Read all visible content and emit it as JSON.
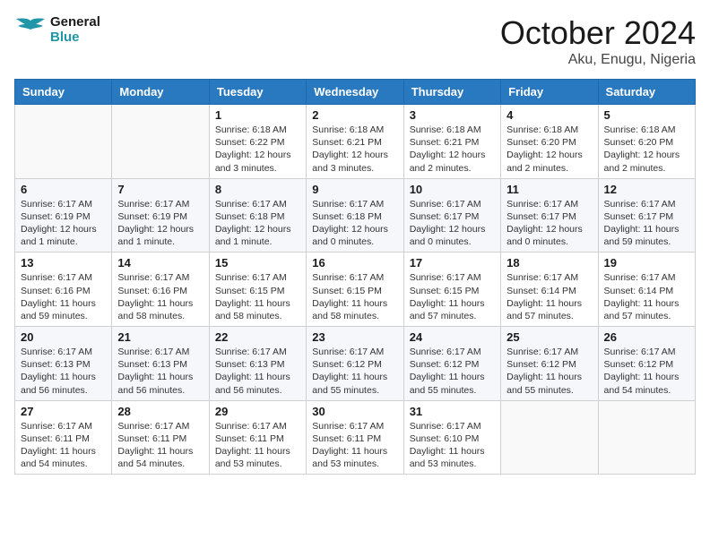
{
  "header": {
    "logo_line1": "General",
    "logo_line2": "Blue",
    "month_title": "October 2024",
    "location": "Aku, Enugu, Nigeria"
  },
  "weekdays": [
    "Sunday",
    "Monday",
    "Tuesday",
    "Wednesday",
    "Thursday",
    "Friday",
    "Saturday"
  ],
  "weeks": [
    [
      {
        "day": "",
        "info": ""
      },
      {
        "day": "",
        "info": ""
      },
      {
        "day": "1",
        "info": "Sunrise: 6:18 AM\nSunset: 6:22 PM\nDaylight: 12 hours and 3 minutes."
      },
      {
        "day": "2",
        "info": "Sunrise: 6:18 AM\nSunset: 6:21 PM\nDaylight: 12 hours and 3 minutes."
      },
      {
        "day": "3",
        "info": "Sunrise: 6:18 AM\nSunset: 6:21 PM\nDaylight: 12 hours and 2 minutes."
      },
      {
        "day": "4",
        "info": "Sunrise: 6:18 AM\nSunset: 6:20 PM\nDaylight: 12 hours and 2 minutes."
      },
      {
        "day": "5",
        "info": "Sunrise: 6:18 AM\nSunset: 6:20 PM\nDaylight: 12 hours and 2 minutes."
      }
    ],
    [
      {
        "day": "6",
        "info": "Sunrise: 6:17 AM\nSunset: 6:19 PM\nDaylight: 12 hours and 1 minute."
      },
      {
        "day": "7",
        "info": "Sunrise: 6:17 AM\nSunset: 6:19 PM\nDaylight: 12 hours and 1 minute."
      },
      {
        "day": "8",
        "info": "Sunrise: 6:17 AM\nSunset: 6:18 PM\nDaylight: 12 hours and 1 minute."
      },
      {
        "day": "9",
        "info": "Sunrise: 6:17 AM\nSunset: 6:18 PM\nDaylight: 12 hours and 0 minutes."
      },
      {
        "day": "10",
        "info": "Sunrise: 6:17 AM\nSunset: 6:17 PM\nDaylight: 12 hours and 0 minutes."
      },
      {
        "day": "11",
        "info": "Sunrise: 6:17 AM\nSunset: 6:17 PM\nDaylight: 12 hours and 0 minutes."
      },
      {
        "day": "12",
        "info": "Sunrise: 6:17 AM\nSunset: 6:17 PM\nDaylight: 11 hours and 59 minutes."
      }
    ],
    [
      {
        "day": "13",
        "info": "Sunrise: 6:17 AM\nSunset: 6:16 PM\nDaylight: 11 hours and 59 minutes."
      },
      {
        "day": "14",
        "info": "Sunrise: 6:17 AM\nSunset: 6:16 PM\nDaylight: 11 hours and 58 minutes."
      },
      {
        "day": "15",
        "info": "Sunrise: 6:17 AM\nSunset: 6:15 PM\nDaylight: 11 hours and 58 minutes."
      },
      {
        "day": "16",
        "info": "Sunrise: 6:17 AM\nSunset: 6:15 PM\nDaylight: 11 hours and 58 minutes."
      },
      {
        "day": "17",
        "info": "Sunrise: 6:17 AM\nSunset: 6:15 PM\nDaylight: 11 hours and 57 minutes."
      },
      {
        "day": "18",
        "info": "Sunrise: 6:17 AM\nSunset: 6:14 PM\nDaylight: 11 hours and 57 minutes."
      },
      {
        "day": "19",
        "info": "Sunrise: 6:17 AM\nSunset: 6:14 PM\nDaylight: 11 hours and 57 minutes."
      }
    ],
    [
      {
        "day": "20",
        "info": "Sunrise: 6:17 AM\nSunset: 6:13 PM\nDaylight: 11 hours and 56 minutes."
      },
      {
        "day": "21",
        "info": "Sunrise: 6:17 AM\nSunset: 6:13 PM\nDaylight: 11 hours and 56 minutes."
      },
      {
        "day": "22",
        "info": "Sunrise: 6:17 AM\nSunset: 6:13 PM\nDaylight: 11 hours and 56 minutes."
      },
      {
        "day": "23",
        "info": "Sunrise: 6:17 AM\nSunset: 6:12 PM\nDaylight: 11 hours and 55 minutes."
      },
      {
        "day": "24",
        "info": "Sunrise: 6:17 AM\nSunset: 6:12 PM\nDaylight: 11 hours and 55 minutes."
      },
      {
        "day": "25",
        "info": "Sunrise: 6:17 AM\nSunset: 6:12 PM\nDaylight: 11 hours and 55 minutes."
      },
      {
        "day": "26",
        "info": "Sunrise: 6:17 AM\nSunset: 6:12 PM\nDaylight: 11 hours and 54 minutes."
      }
    ],
    [
      {
        "day": "27",
        "info": "Sunrise: 6:17 AM\nSunset: 6:11 PM\nDaylight: 11 hours and 54 minutes."
      },
      {
        "day": "28",
        "info": "Sunrise: 6:17 AM\nSunset: 6:11 PM\nDaylight: 11 hours and 54 minutes."
      },
      {
        "day": "29",
        "info": "Sunrise: 6:17 AM\nSunset: 6:11 PM\nDaylight: 11 hours and 53 minutes."
      },
      {
        "day": "30",
        "info": "Sunrise: 6:17 AM\nSunset: 6:11 PM\nDaylight: 11 hours and 53 minutes."
      },
      {
        "day": "31",
        "info": "Sunrise: 6:17 AM\nSunset: 6:10 PM\nDaylight: 11 hours and 53 minutes."
      },
      {
        "day": "",
        "info": ""
      },
      {
        "day": "",
        "info": ""
      }
    ]
  ]
}
